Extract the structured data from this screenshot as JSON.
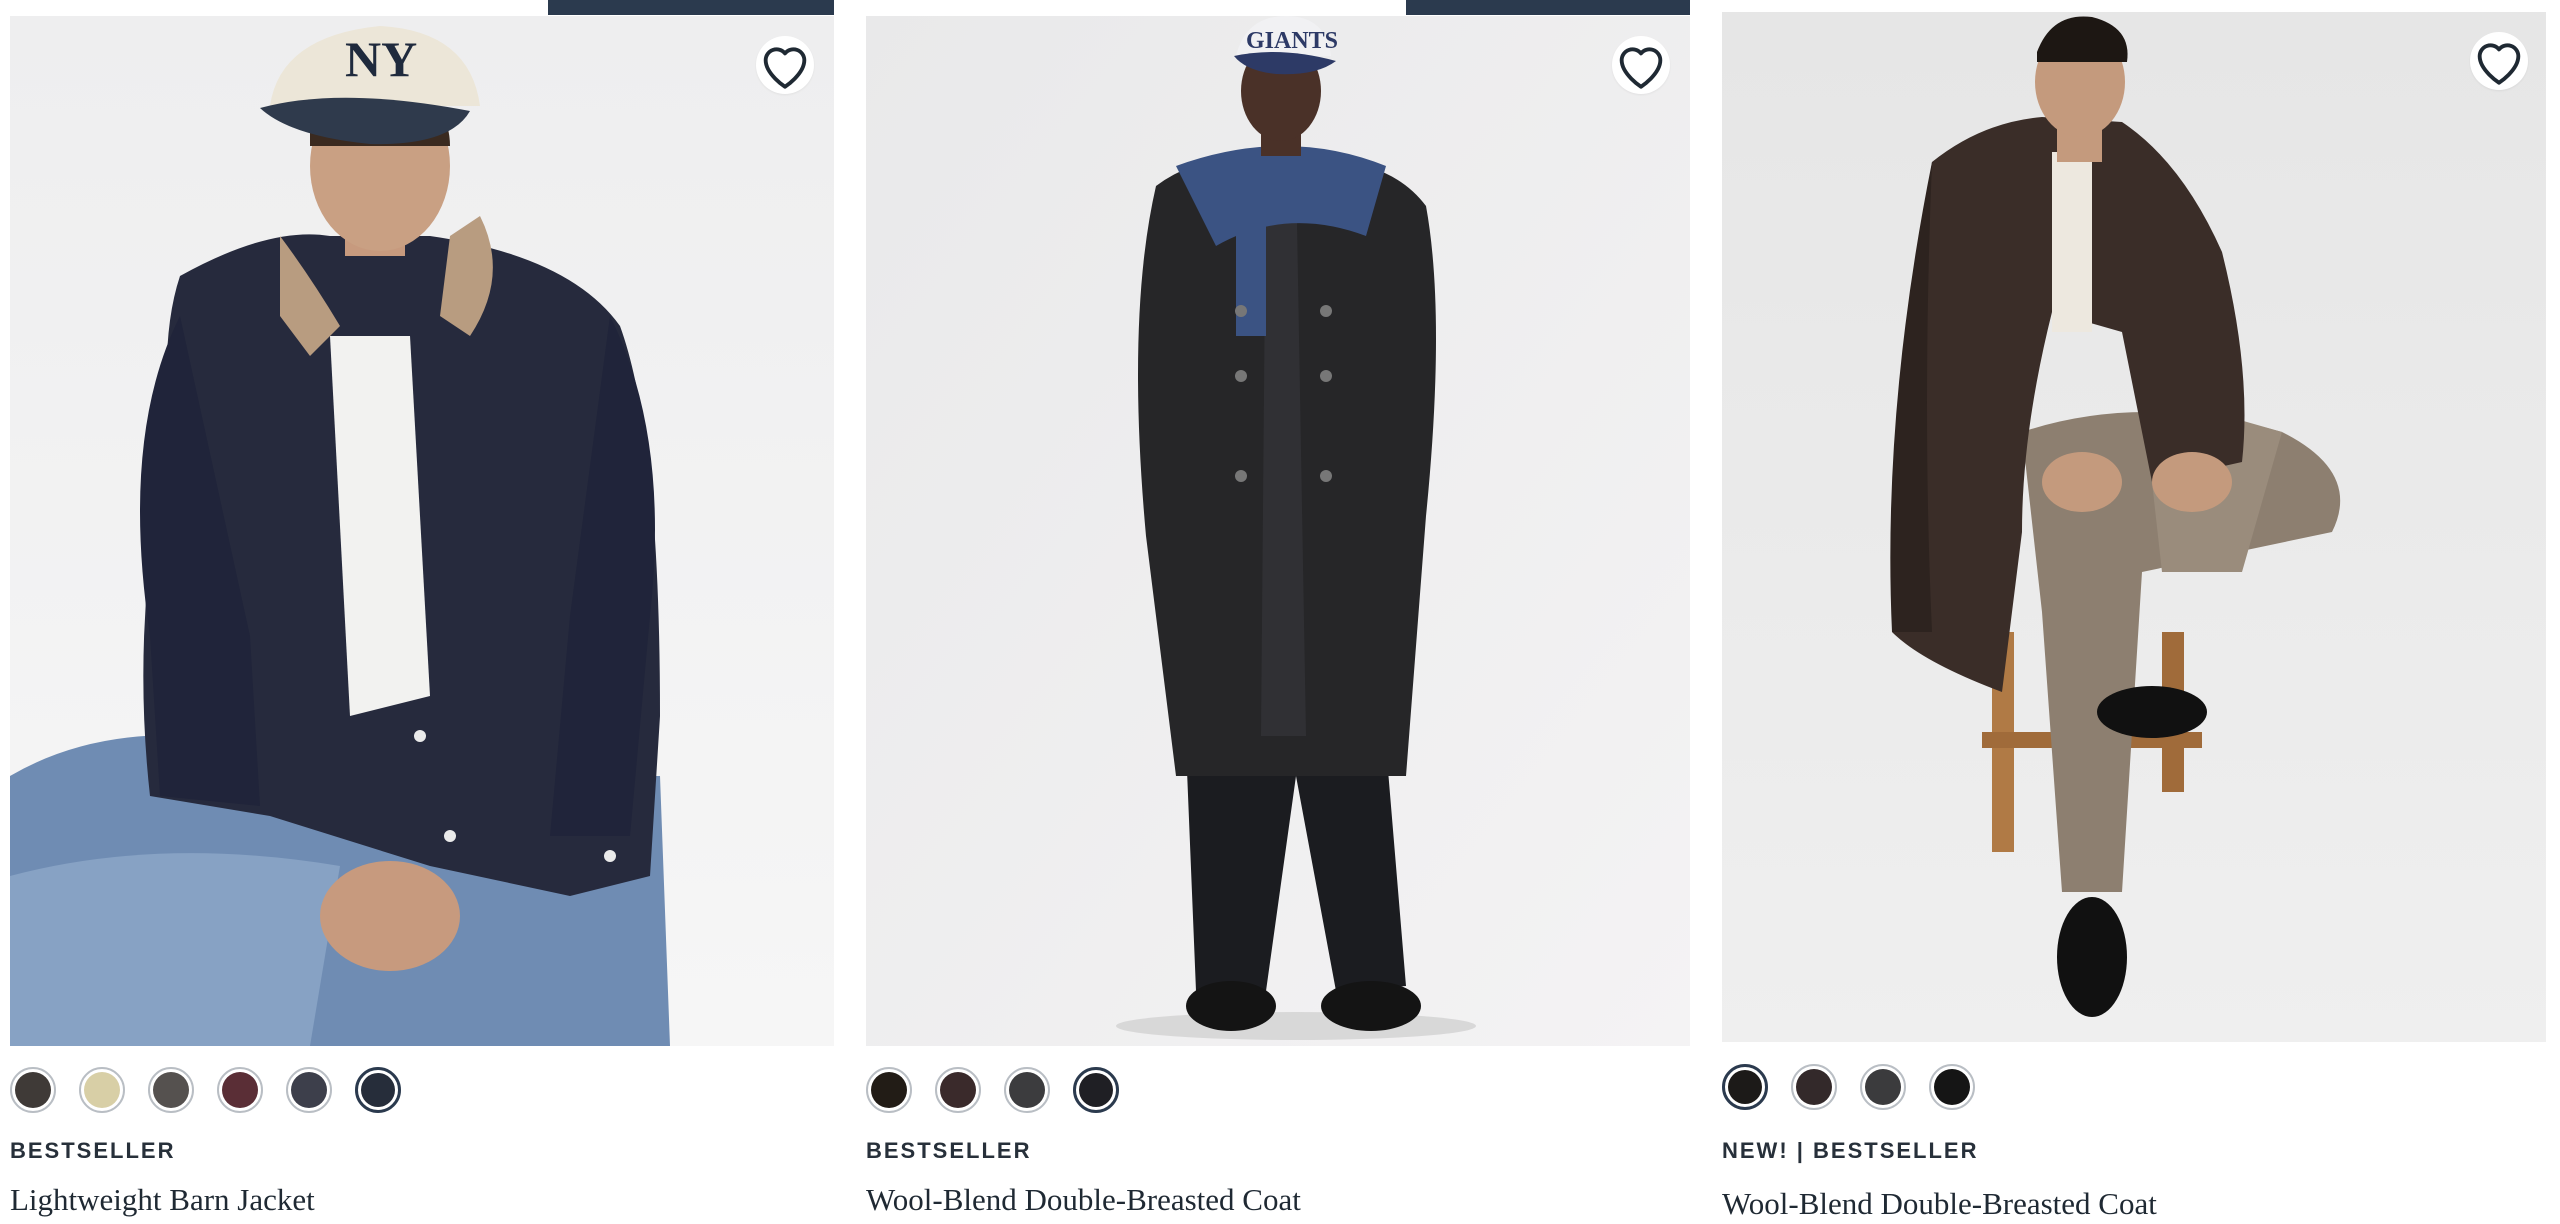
{
  "products": [
    {
      "badge": "BESTSELLER",
      "title": "Lightweight Barn Jacket",
      "wishlist_icon": "heart-icon",
      "swatches": [
        {
          "color": "#3f3a37",
          "selected": false
        },
        {
          "color": "#d8cfa6",
          "selected": false
        },
        {
          "color": "#55514f",
          "selected": false
        },
        {
          "color": "#5a2e36",
          "selected": false
        },
        {
          "color": "#3d3f4b",
          "selected": false
        },
        {
          "color": "#262d3a",
          "selected": true
        }
      ]
    },
    {
      "badge": "BESTSELLER",
      "title": "Wool-Blend Double-Breasted Coat",
      "wishlist_icon": "heart-icon",
      "swatches": [
        {
          "color": "#221c16",
          "selected": false
        },
        {
          "color": "#3a2a2b",
          "selected": false
        },
        {
          "color": "#3c3c3e",
          "selected": false
        },
        {
          "color": "#1f1f24",
          "selected": true
        }
      ]
    },
    {
      "badge": "NEW! | BESTSELLER",
      "title": "Wool-Blend Double-Breasted Coat",
      "wishlist_icon": "heart-icon",
      "swatches": [
        {
          "color": "#1c1a18",
          "selected": true
        },
        {
          "color": "#33292a",
          "selected": false
        },
        {
          "color": "#3b3b3d",
          "selected": false
        },
        {
          "color": "#151515",
          "selected": false
        }
      ]
    }
  ],
  "colors": {
    "accent": "#2b3a4e",
    "text": "#1f2933"
  }
}
